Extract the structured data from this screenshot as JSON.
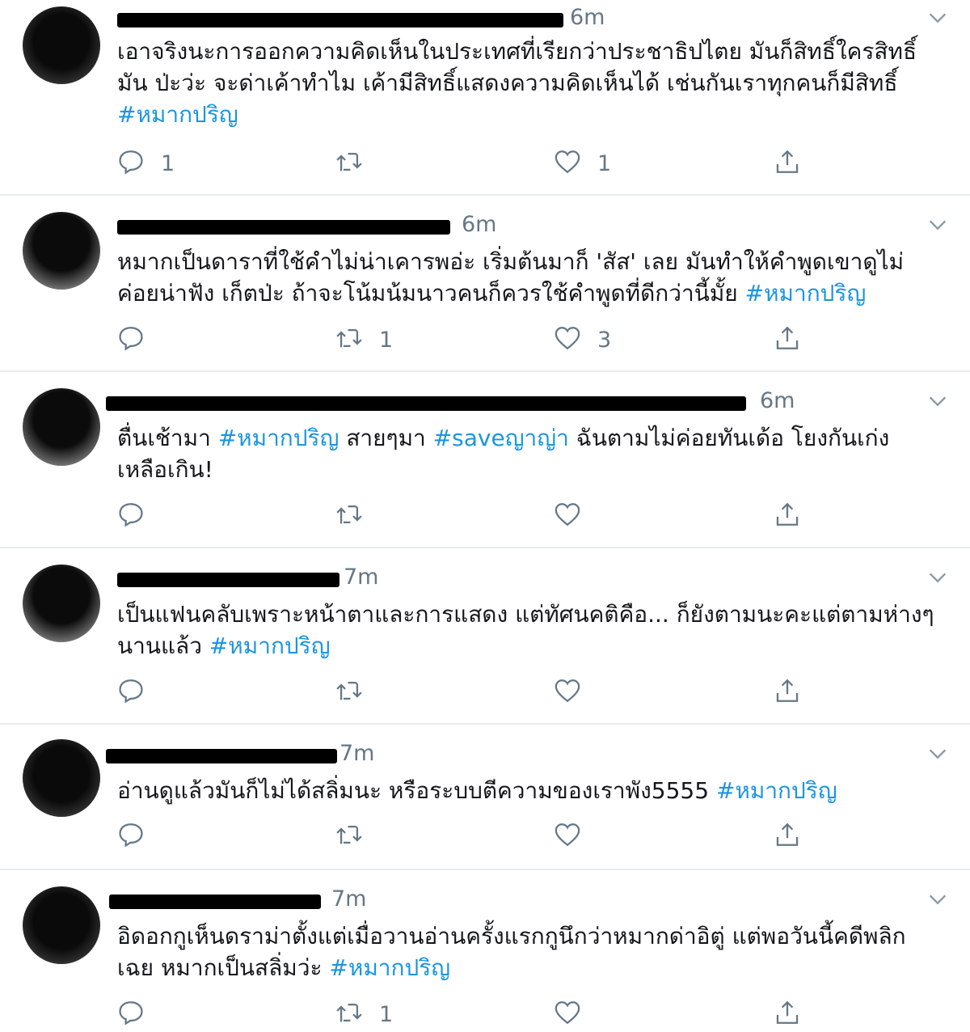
{
  "tweets": [
    {
      "time": "6m",
      "text": "เอาจริงนะการออกความคิดเห็นในประเทศที่เรียกว่าประชาธิปไตย มันก็สิทธิ์ใครสิทธิ์มัน ป่ะว่ะ  จะด่าเค้าทำไม เค้ามีสิทธิ์แสดงความคิดเห็นได้ เช่นกันเราทุกคนก็มีสิทธิ์",
      "hashtags": [
        "#หมากปริญ"
      ],
      "reply_count": "1",
      "retweet_count": "",
      "like_count": "1"
    },
    {
      "time": "6m",
      "text": "หมากเป็นดาราที่ใช้คำไม่น่าเคารพอ่ะ เริ่มต้นมาก็ 'สัส' เลย มันทำให้คำพูดเขาดูไม่ค่อยน่าฟัง เก็ตป่ะ ถ้าจะโน้มน้มนาวคนก็ควรใช้คำพูดที่ดีกว่านี้มั้ย",
      "hashtags": [
        "#หมากปริญ"
      ],
      "reply_count": "",
      "retweet_count": "1",
      "like_count": "3"
    },
    {
      "time": "6m",
      "text_parts": [
        "ตื่นเช้ามา ",
        "#หมากปริญ",
        " สายๆมา ",
        "#saveญาญ่า",
        " ฉันตามไม่ค่อยทันเด้อ โยงกันเก่งเหลือเกิน!"
      ],
      "reply_count": "",
      "retweet_count": "",
      "like_count": ""
    },
    {
      "time": "7m",
      "text": "เป็นแฟนคลับเพราะหน้าตาและการแสดง แต่ทัศนคติคือ... ก็ยังตามนะคะแต่ตามห่างๆนานแล้ว",
      "hashtags": [
        "#หมากปริญ"
      ],
      "reply_count": "",
      "retweet_count": "",
      "like_count": ""
    },
    {
      "time": "7m",
      "text": "อ่านดูแล้วมันก็ไม่ได้สลิ่มนะ หรือระบบตีความของเราพัง5555",
      "hashtags": [
        "#หมากปริญ"
      ],
      "reply_count": "",
      "retweet_count": "",
      "like_count": ""
    },
    {
      "time": "7m",
      "text": "อิดอกกูเห็นดราม่าตั้งแต่เมื่อวานอ่านครั้งแรกกูนึกว่าหมากด่าอิตู่ แต่พอวันนี้คดีพลิกเฉย หมากเป็นสลิ่มว่ะ",
      "hashtags": [
        "#หมากปริญ"
      ],
      "reply_count": "",
      "retweet_count": "1",
      "like_count": ""
    }
  ],
  "colors": {
    "hashtag": "#1b95e0",
    "meta": "#657786",
    "divider": "#e6ecf0"
  },
  "icons": {
    "reply": "comment-bubble-icon",
    "retweet": "retweet-icon",
    "like": "heart-icon",
    "share": "share-upload-icon",
    "menu": "chevron-down-icon"
  }
}
